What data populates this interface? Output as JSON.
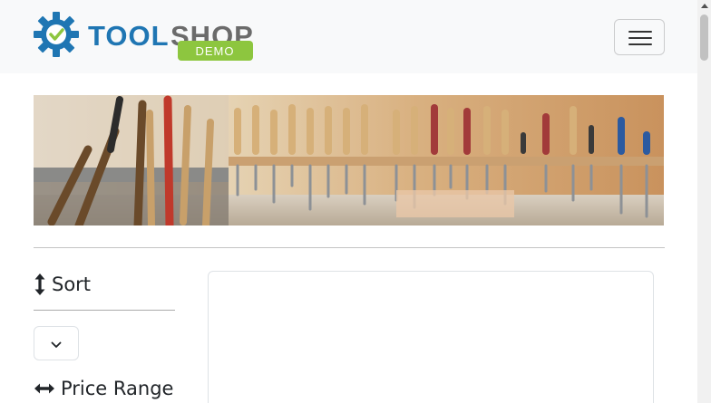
{
  "brand": {
    "name_part1": "TOOL",
    "name_part2": "SHOP",
    "badge": "DEMO",
    "colors": {
      "primary": "#1f76b3",
      "secondary": "#6b6b6b",
      "badge_bg": "#8dc63f",
      "check": "#8dc63f"
    }
  },
  "nav": {
    "toggler_icon": "hamburger-icon"
  },
  "banner": {
    "subject": "tool-rack-image"
  },
  "sidebar": {
    "sort": {
      "label": "Sort",
      "icon": "sort-vertical-icon",
      "select_icon": "chevron-down-icon"
    },
    "price_range": {
      "label": "Price Range",
      "icon": "horizontal-arrows-icon"
    }
  },
  "colors": {
    "navbar_bg": "#f8f9fa",
    "text": "#212529"
  }
}
